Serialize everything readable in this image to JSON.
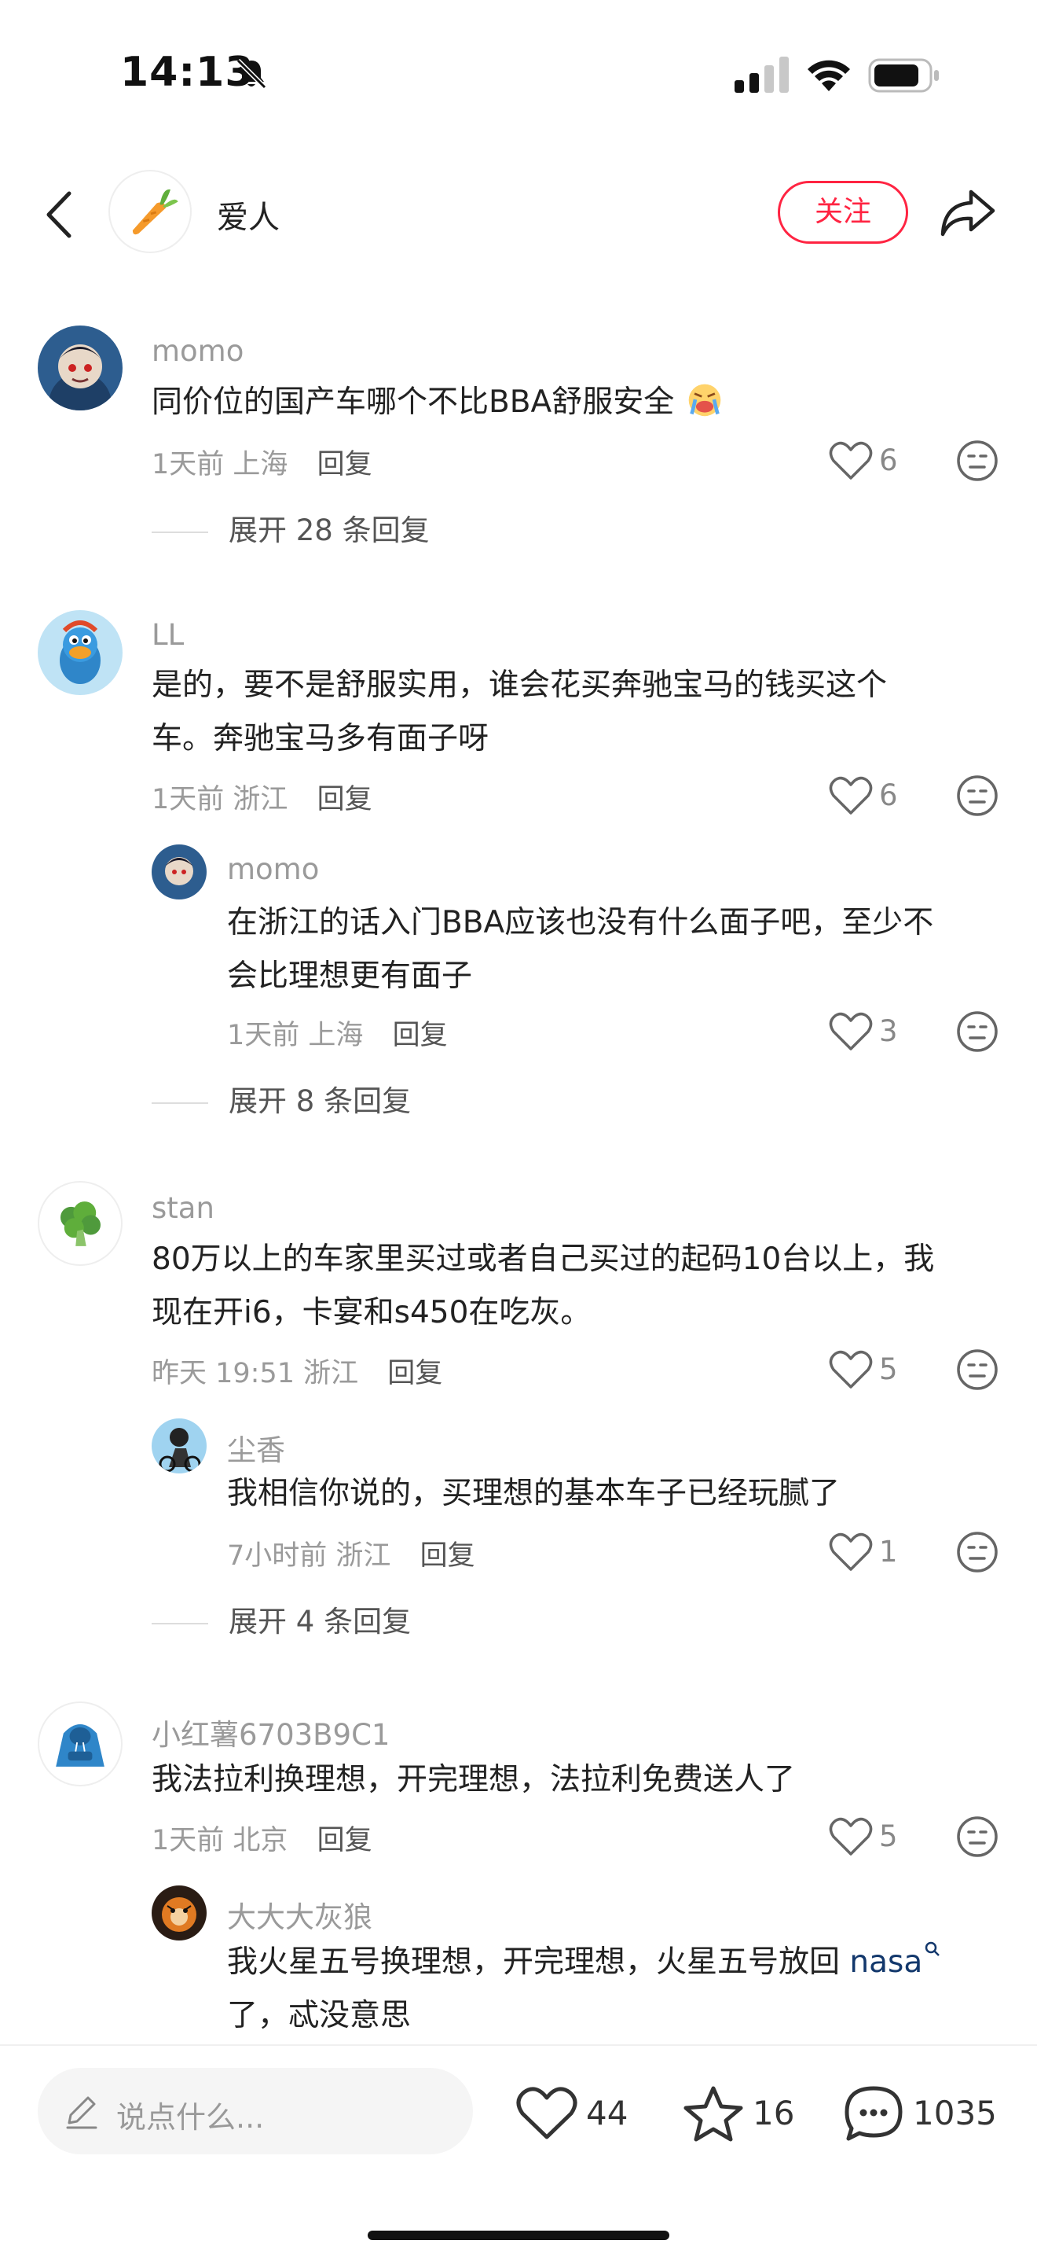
{
  "status_bar": {
    "time": "14:13"
  },
  "header": {
    "title": "爱人",
    "follow_label": "关注"
  },
  "comments": [
    {
      "user": "momo",
      "text_lines": [
        "同价位的国产车哪个不比BBA舒服安全"
      ],
      "time": "1天前",
      "location": "上海",
      "reply_label": "回复",
      "likes": "6",
      "expand": "展开 28 条回复",
      "replies": []
    },
    {
      "user": "LL",
      "text_lines": [
        "是的，要不是舒服实用，谁会花买奔驰宝马的钱买这个",
        "车。奔驰宝马多有面子呀"
      ],
      "time": "1天前",
      "location": "浙江",
      "reply_label": "回复",
      "likes": "6",
      "expand": "展开 8 条回复",
      "replies": [
        {
          "user": "momo",
          "text_lines": [
            "在浙江的话入门BBA应该也没有什么面子吧，至少不",
            "会比理想更有面子"
          ],
          "time": "1天前",
          "location": "上海",
          "reply_label": "回复",
          "likes": "3"
        }
      ]
    },
    {
      "user": "stan",
      "text_lines": [
        "80万以上的车家里买过或者自己买过的起码10台以上，我",
        "现在开i6，卡宴和s450在吃灰。"
      ],
      "time": "昨天 19:51",
      "location": "浙江",
      "reply_label": "回复",
      "likes": "5",
      "expand": "展开 4 条回复",
      "replies": [
        {
          "user": "尘香",
          "text_lines": [
            "我相信你说的，买理想的基本车子已经玩腻了"
          ],
          "time": "7小时前",
          "location": "浙江",
          "reply_label": "回复",
          "likes": "1"
        }
      ]
    },
    {
      "user": "小红薯6703B9C1",
      "text_lines": [
        "我法拉利换理想，开完理想，法拉利免费送人了"
      ],
      "time": "1天前",
      "location": "北京",
      "reply_label": "回复",
      "likes": "5",
      "expand": "",
      "replies": [
        {
          "user": "大大大灰狼",
          "text_lines": [
            "我火星五号换理想，开完理想，火星五号放回",
            "了，忒没意思"
          ],
          "link": "nasa",
          "time": "",
          "location": "",
          "reply_label": "",
          "likes": ""
        }
      ]
    }
  ],
  "bottom_bar": {
    "input_placeholder": "说点什么...",
    "likes": "44",
    "favorites": "16",
    "comments": "1035"
  },
  "icons": {
    "back": "chevron-left-icon",
    "share": "share-arrow-icon",
    "like": "heart-outline-icon",
    "dislike": "meh-face-icon",
    "edit": "pencil-icon",
    "favorite": "star-outline-icon",
    "comment": "chat-bubble-icon"
  },
  "colors": {
    "accent": "#ff2442",
    "link": "#13386c"
  }
}
